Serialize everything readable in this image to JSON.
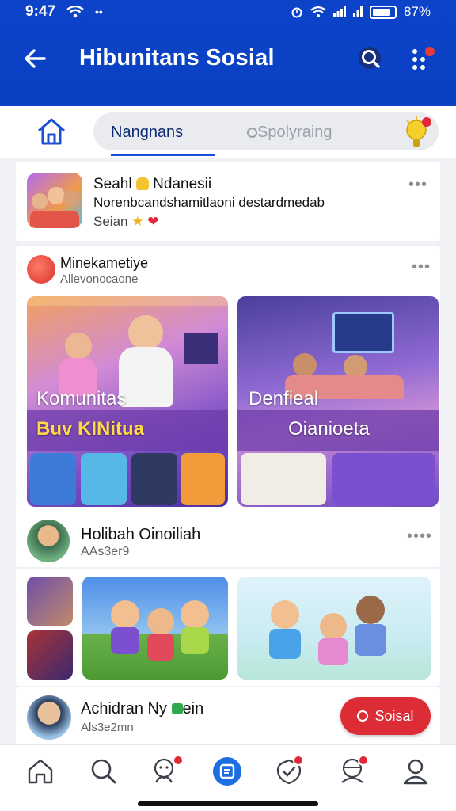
{
  "status_bar": {
    "time": "9:47",
    "battery_percent": "87%"
  },
  "header": {
    "title": "Hibunitans Sosial"
  },
  "tabs": {
    "active_label": "Nangnans",
    "search_placeholder": "Spolyraing"
  },
  "post1": {
    "name": "Seahl",
    "name_suffix": "Ndanesii",
    "text": "Norenbcandshamitlaoni destardmedab",
    "meta": "Seian",
    "menu": "•••"
  },
  "feed": {
    "name": "Minekametiye",
    "sub": "Allevonocaone",
    "menu": "•••",
    "tile_a": {
      "title": "Komunitas",
      "subtitle": "Buv KINitua"
    },
    "tile_b": {
      "title": "Denfieal",
      "subtitle": "Oianioeta"
    }
  },
  "person": {
    "name": "Holibah Oinoiliah",
    "sub": "AAs3er9",
    "menu": "••••"
  },
  "post3": {
    "name": "Achidran Ny",
    "name_suffix": "ein",
    "sub": "Als3e2mn",
    "button_label": "Soisal"
  },
  "icons": {
    "back": "arrow-left-icon",
    "search": "search-icon",
    "more": "more-dots-icon",
    "home": "home-icon",
    "bulb": "lightbulb-icon",
    "nav": [
      "home-icon",
      "search-icon",
      "friends-icon",
      "center-tab-icon",
      "check-shield-icon",
      "chat-people-icon",
      "profile-icon"
    ]
  },
  "colors": {
    "brand": "#0c43c9",
    "accent": "#1b4fd4",
    "danger": "#dc2c36"
  }
}
